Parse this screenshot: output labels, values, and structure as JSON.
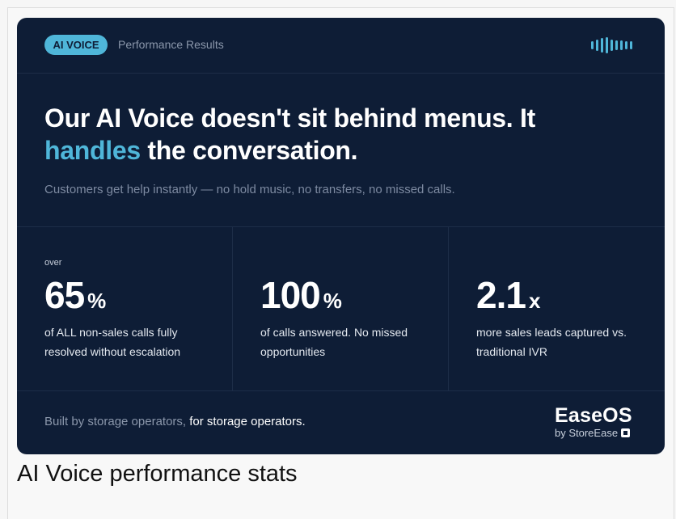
{
  "badge": "AI VOICE",
  "topbar_label": "Performance Results",
  "headline": {
    "line1": "Our AI Voice doesn't sit behind menus. It",
    "accent": "handles",
    "rest": " the conversation."
  },
  "subline": "Customers get help instantly — no hold music, no transfers, no missed calls.",
  "stats": [
    {
      "prefix": "over",
      "value": "65",
      "unit": "%",
      "desc": "of ALL non-sales calls fully resolved without escalation"
    },
    {
      "prefix": "",
      "value": "100",
      "unit": "%",
      "desc": "of calls answered. No missed opportunities"
    },
    {
      "prefix": "",
      "value": "2.1",
      "unit": "x",
      "desc": "more sales leads captured vs. traditional IVR"
    }
  ],
  "footer": {
    "muted": "Built by storage operators,",
    "strong": " for storage operators."
  },
  "logo": {
    "name": "EaseOS",
    "sub": "by StoreEase"
  },
  "caption": "AI Voice performance stats",
  "colors": {
    "background": "#0e1d36",
    "accent": "#4fb6d9"
  },
  "icons": [
    "soundwave-icon",
    "storeease-logo-icon"
  ]
}
